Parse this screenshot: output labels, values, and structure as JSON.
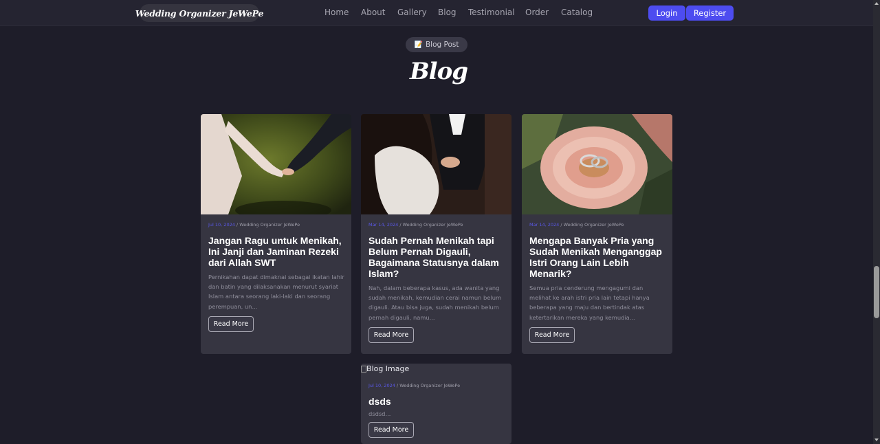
{
  "navbar": {
    "brand": "Wedding Organizer JeWePe",
    "links": [
      "Home",
      "About",
      "Gallery",
      "Blog",
      "Testimonial",
      "Order",
      "Catalog"
    ],
    "login_label": "Login",
    "register_label": "Register"
  },
  "section": {
    "badge": "Blog Post",
    "badge_icon": "memo-icon",
    "title": "Blog"
  },
  "posts": [
    {
      "date": "Jul 10, 2024",
      "author": "Wedding Organizer JeWePe",
      "title": "Jangan Ragu untuk Menikah, Ini Janji dan Jaminan Rezeki dari Allah SWT",
      "excerpt": "Pernikahan dapat dimaknai sebagai ikatan lahir dan batin yang dilaksanakan menurut syariat Islam antara seorang laki-laki dan seorang perempuan, un...",
      "read_more": "Read More",
      "image": "holding-hands-photo"
    },
    {
      "date": "Mar 14, 2024",
      "author": "Wedding Organizer JeWePe",
      "title": "Sudah Pernah Menikah tapi Belum Pernah Digauli, Bagaimana Statusnya dalam Islam?",
      "excerpt": "Nah, dalam beberapa kasus, ada wanita yang sudah menikah, kemudian cerai namun belum digauli. Atau bisa juga, sudah menikah belum pernah digauli, namu...",
      "read_more": "Read More",
      "image": "couple-dancing-photo"
    },
    {
      "date": "Mar 14, 2024",
      "author": "Wedding Organizer JeWePe",
      "title": "Mengapa Banyak Pria yang Sudah Menikah Menganggap Istri Orang Lain Lebih Menarik?",
      "excerpt": "Semua pria cenderung mengagumi dan melihat ke arah istri pria lain tetapi hanya beberapa yang maju dan bertindak atas ketertarikan mereka yang kemudia...",
      "read_more": "Read More",
      "image": "rings-on-flower-photo"
    },
    {
      "date": "Jul 10, 2024",
      "author": "Wedding Organizer JeWePe",
      "title": "dsds",
      "excerpt": "dsdsd...",
      "read_more": "Read More",
      "image_alt": "Blog Image"
    }
  ],
  "colors": {
    "background": "#1e1d29",
    "card": "#363541",
    "accent": "#4d4cf0",
    "date": "#5a58e8"
  }
}
